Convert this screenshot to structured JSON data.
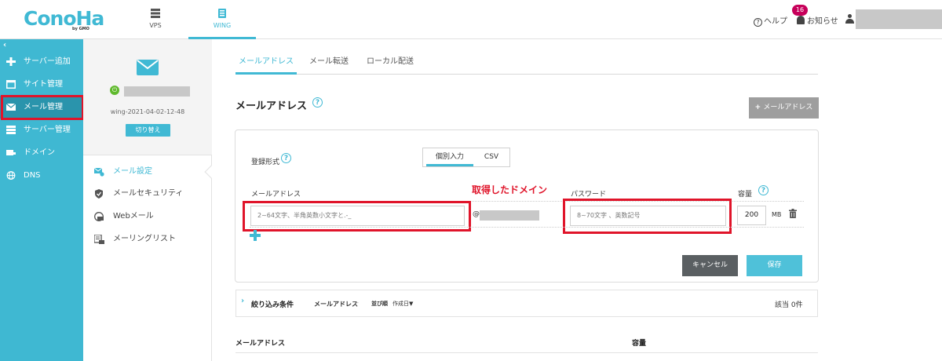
{
  "brand": {
    "logo": "ConoHa",
    "logo_sub": "by GMO"
  },
  "topnav": [
    {
      "label": "VPS"
    },
    {
      "label": "WING"
    }
  ],
  "header": {
    "help": "ヘルプ",
    "notice": "お知らせ",
    "notice_count": "16"
  },
  "sidebar": {
    "collapse": "‹",
    "items": [
      {
        "label": "サーバー追加"
      },
      {
        "label": "サイト管理"
      },
      {
        "label": "メール管理"
      },
      {
        "label": "サーバー管理"
      },
      {
        "label": "ドメイン"
      },
      {
        "label": "DNS"
      }
    ]
  },
  "server_panel": {
    "server_name": "wing-2021-04-02-12-48",
    "switch_label": "切り替え"
  },
  "sub_menu": [
    {
      "label": "メール設定"
    },
    {
      "label": "メールセキュリティ"
    },
    {
      "label": "Webメール"
    },
    {
      "label": "メーリングリスト"
    }
  ],
  "tabs": [
    {
      "label": "メールアドレス"
    },
    {
      "label": "メール転送"
    },
    {
      "label": "ローカル配送"
    }
  ],
  "page": {
    "title": "メールアドレス",
    "add_button": "メールアドレス"
  },
  "form": {
    "registration_label": "登録形式",
    "mode_options": [
      {
        "label": "個別入力"
      },
      {
        "label": "CSV"
      }
    ],
    "col_address": "メールアドレス",
    "col_password": "パスワード",
    "col_capacity": "容量",
    "address_placeholder": "2~64文字、半角英数小文字と.-_",
    "at": "@",
    "password_placeholder": "8~70文字 、英数記号",
    "capacity_value": "200",
    "capacity_unit": "MB",
    "cancel": "キャンセル",
    "save": "保存"
  },
  "annotation": "取得したドメイン",
  "filter": {
    "title": "絞り込み条件",
    "field": "メールアドレス",
    "dash": "-",
    "sort_label": "並び順",
    "sort_value": "作成日▼",
    "count": "該当 0件"
  },
  "list": {
    "col_address": "メールアドレス",
    "col_capacity": "容量"
  },
  "colors": {
    "accent": "#40b9d4",
    "sidebar": "#3fb8d2",
    "annotation": "#e0142a",
    "badge": "#c7005a"
  }
}
